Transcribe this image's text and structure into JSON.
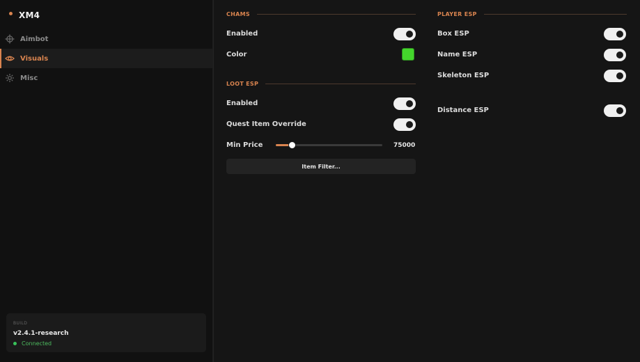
{
  "app": {
    "title": "XM4"
  },
  "sidebar": {
    "items": [
      {
        "label": "Aimbot",
        "icon": "crosshair-icon",
        "active": false
      },
      {
        "label": "Visuals",
        "icon": "eye-icon",
        "active": true
      },
      {
        "label": "Misc",
        "icon": "gear-icon",
        "active": false
      }
    ]
  },
  "build": {
    "label": "BUILD",
    "version": "v2.4.1-research",
    "status": "Connected"
  },
  "chams": {
    "title": "CHAMS",
    "enabled_label": "Enabled",
    "enabled": true,
    "color_label": "Color",
    "color": "#44d62c"
  },
  "loot": {
    "title": "LOOT ESP",
    "enabled_label": "Enabled",
    "enabled": true,
    "quest_label": "Quest Item Override",
    "quest": true,
    "min_price_label": "Min Price",
    "min_price": "75000",
    "min_price_fraction": 0.15,
    "filter_button": "Item Filter..."
  },
  "player": {
    "title": "PLAYER ESP",
    "box_label": "Box ESP",
    "box": true,
    "name_label": "Name ESP",
    "name": true,
    "skeleton_label": "Skeleton ESP",
    "skeleton": true,
    "distance_label": "Distance ESP",
    "distance": true
  },
  "colors": {
    "accent": "#d9844f",
    "status": "#39c25a"
  }
}
